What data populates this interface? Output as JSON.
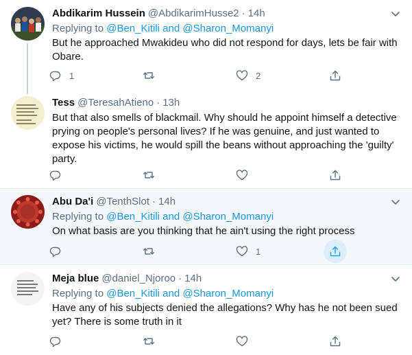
{
  "tweets": [
    {
      "name": "Abdikarim Hussein",
      "handle": "@AbdikarimHusse2",
      "sep": "·",
      "time": "14h",
      "replying_prefix": "Replying to",
      "mention1": "@Ben_Kitili",
      "and": "and",
      "mention2": "@Sharon_Momanyi",
      "text": "But he approached Mwakideu who did not respond for days, lets be fair with Obare.",
      "reply_count": "1",
      "retweet_count": "",
      "like_count": "2"
    },
    {
      "name": "Tess",
      "handle": "@TeresahAtieno",
      "sep": "·",
      "time": "13h",
      "text": "But that also smells of blackmail. Why should he appoint himself a detective prying on people's personal lives? If he was genuine, and just wanted to expose his victims, he would spill the beans without approaching the  'guilty' party.",
      "reply_count": "",
      "retweet_count": "",
      "like_count": ""
    },
    {
      "name": "Abu Da'i",
      "handle": "@TenthSlot",
      "sep": "·",
      "time": "14h",
      "replying_prefix": "Replying to",
      "mention1": "@Ben_Kitili",
      "and": "and",
      "mention2": "@Sharon_Momanyi",
      "text": "On what basis are you thinking that he ain't using the right process",
      "reply_count": "",
      "retweet_count": "",
      "like_count": "1"
    },
    {
      "name": "Meja blue",
      "handle": "@daniel_Njoroo",
      "sep": "·",
      "time": "14h",
      "replying_prefix": "Replying to",
      "mention1": "@Ben_Kitili",
      "and": "and",
      "mention2": "@Sharon_Momanyi",
      "text": "Have any of his subjects denied the allegations? Why has he not been sued yet? There is some truth in it",
      "reply_count": "",
      "retweet_count": "",
      "like_count": ""
    }
  ],
  "icons": {
    "reply": "reply-icon",
    "retweet": "retweet-icon",
    "like": "heart-icon",
    "share": "share-icon",
    "more": "chevron-down-icon"
  },
  "colors": {
    "link": "#1b95e0",
    "muted": "#5b7083",
    "text": "#0f1419",
    "highlight_bg": "#f5f8fa",
    "share_active": "#1da1f2"
  }
}
